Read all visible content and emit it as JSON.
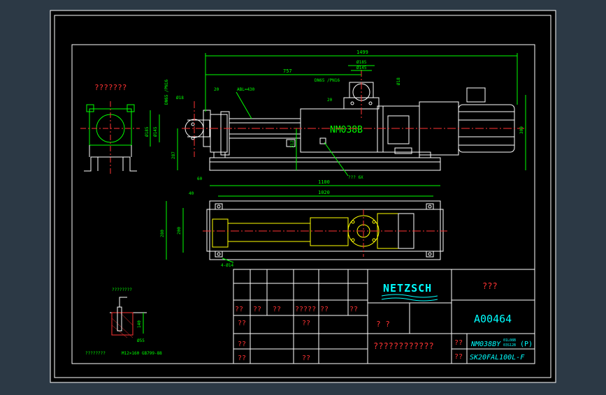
{
  "title_block": {
    "company_logo": "NETZSCH",
    "drawing_title": "???",
    "drawing_number": "A00464",
    "model": "NM038BY",
    "model_sub_1": "01L08B",
    "model_sub_2": "03S12B",
    "model_suffix": "(P)",
    "motor": "SK20FAL100L-F",
    "description": "????????????",
    "cells": [
      "??",
      "??",
      "??",
      "?????",
      "??",
      "??",
      "??",
      "??",
      "??",
      "??",
      "??",
      "?  ?",
      "??",
      "??"
    ]
  },
  "left_view": {
    "label": "???????"
  },
  "top_view_labels": {
    "pump_model": "NM038B",
    "abl": "ABL=430",
    "flange_in": "DN65 /PN16",
    "flange_out": "DN65 /PN16",
    "bolt_note": "??? 6X",
    "d_18_a": "Ø18",
    "d_18_b": "Ø18",
    "d_185_a": "Ø185",
    "d_145_a": "Ø145",
    "d_185_b": "Ø185",
    "d_145_b": "Ø145"
  },
  "dimensions": {
    "d1499": "1499",
    "d757": "757",
    "d20a": "20",
    "d20b": "20",
    "d309": "309",
    "d312": "312",
    "d287": "287",
    "d60": "60",
    "d1100": "1100",
    "d40": "40",
    "d1020": "1020",
    "d280": "280",
    "d200": "200",
    "d4x14": "4-Ø14",
    "d140": "140",
    "d55": "Ø55"
  },
  "bolt_detail": {
    "label_top": "????????",
    "label_bottom": "????????",
    "spec": "M12×160 GB799-88"
  }
}
